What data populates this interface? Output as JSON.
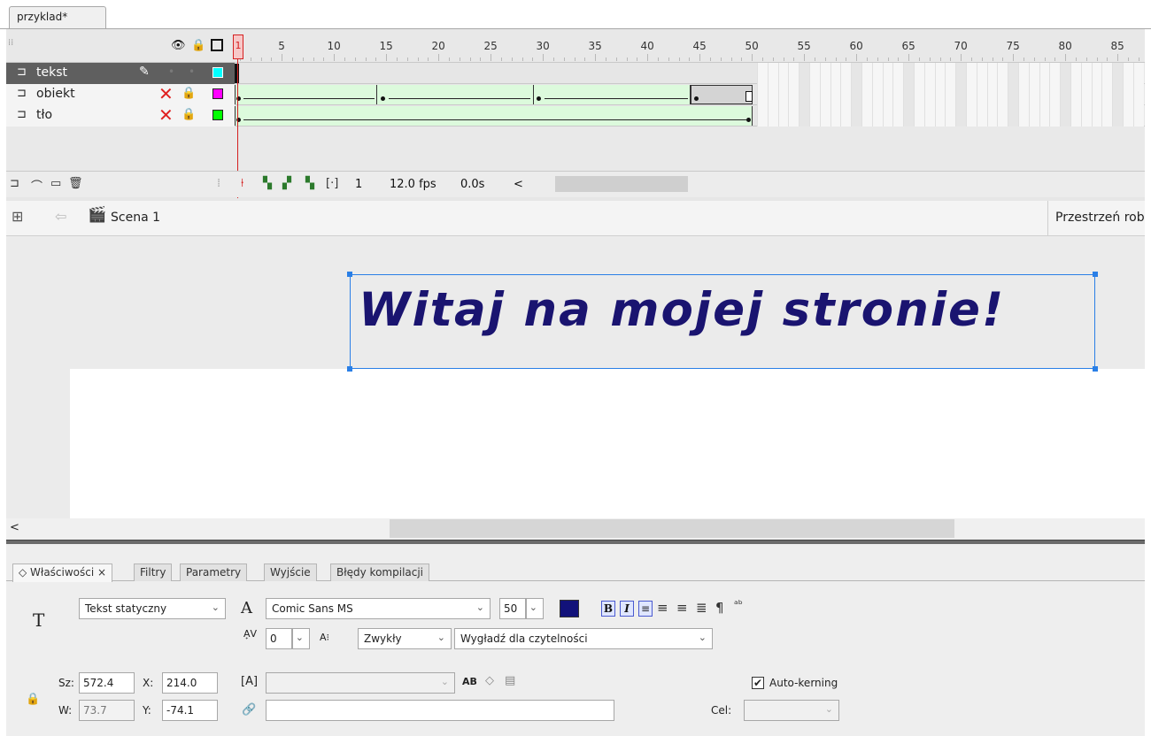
{
  "document": {
    "tab_title": "przyklad*"
  },
  "timeline": {
    "header_icons": [
      "eye-icon",
      "lock-icon",
      "outline-icon"
    ],
    "current_frame_marker": "1",
    "frame_numbers": [
      "5",
      "10",
      "15",
      "20",
      "25",
      "30",
      "35",
      "40",
      "45",
      "50",
      "55",
      "60",
      "65",
      "70",
      "75",
      "80",
      "85"
    ],
    "layers": [
      {
        "name": "tekst",
        "selected": true,
        "color": "#00ffff",
        "icon": "layer-icon",
        "edit_icon": "pencil-icon"
      },
      {
        "name": "obiekt",
        "selected": false,
        "color": "#ff00ff",
        "icon": "layer-icon",
        "hidden_icon": "red-x-icon",
        "lock_icon": "lock-icon"
      },
      {
        "name": "tło",
        "selected": false,
        "color": "#00ff00",
        "icon": "layer-icon",
        "hidden_icon": "red-x-icon",
        "lock_icon": "lock-icon"
      }
    ],
    "status": {
      "frame": "1",
      "fps": "12.0 fps",
      "time": "0.0s",
      "scroll_left": "<"
    }
  },
  "scene": {
    "name": "Scena 1",
    "workspace_label": "Przestrzeń robocza"
  },
  "stage": {
    "text": "Witaj na mojej stronie!",
    "text_color": "#1a1470",
    "scroll_left": "<"
  },
  "properties": {
    "tabs": [
      {
        "label": "◇ Właściwości ×",
        "active": true
      },
      {
        "label": "Filtry",
        "active": false
      },
      {
        "label": "Parametry",
        "active": false
      },
      {
        "label": "Wyjście",
        "active": false
      },
      {
        "label": "Błędy kompilacji",
        "active": false
      }
    ],
    "tool_glyph": "T",
    "text_type": "Tekst statyczny",
    "font_glyph": "A",
    "font_family": "Comic Sans MS",
    "font_size": "50",
    "text_color": "#12127a",
    "bold_label": "B",
    "italic_label": "I",
    "letter_spacing": "0",
    "position_label": "Zwykły",
    "antialias": "Wygładź dla czytelności",
    "width_label": "Sz:",
    "width_value": "572.4",
    "x_label": "X:",
    "x_value": "214.0",
    "height_label": "W:",
    "height_value": "73.7",
    "y_label": "Y:",
    "y_value": "-74.1",
    "auto_kerning_label": "Auto-kerning",
    "auto_kerning_checked": true,
    "target_label": "Cel:",
    "url_value": "",
    "instance_value": ""
  }
}
